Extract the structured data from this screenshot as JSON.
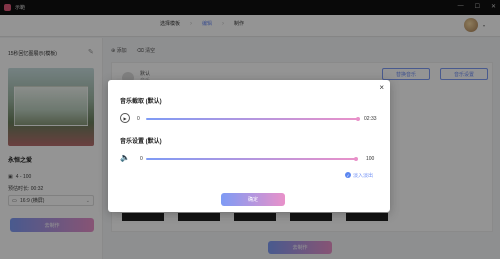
{
  "window": {
    "app_name": "示範",
    "controls": [
      "—",
      "☐",
      "✕"
    ]
  },
  "nav": {
    "steps": [
      "选择模板",
      "编辑",
      "制作"
    ]
  },
  "left_panel": {
    "title": "15秒回忆图展示(模板)",
    "project_name": "永恒之爱",
    "media_count": "4 - 100",
    "duration_label": "预估时长: 00:32",
    "ratio_value": "16:9 (横屏)",
    "make_button": "去制作"
  },
  "main": {
    "toolbar": {
      "add_label": "添加",
      "clear_label": "清空"
    },
    "music_row": {
      "label": "默认",
      "sub": "音乐"
    },
    "replace_music": "替换音乐",
    "music_settings": "音乐设置",
    "bottom_make": "去制作"
  },
  "modal": {
    "section1_title": "音乐截取 (默认)",
    "section1_start": "0",
    "section1_end": "02:33",
    "section2_title": "音乐设置 (默认)",
    "volume_min": "0",
    "volume_max": "100",
    "volume_value": 100,
    "fade_label": "淡入淡出",
    "fade_checked": true,
    "confirm": "确定",
    "close": "×"
  },
  "colors": {
    "accent_start": "#7e9bf5",
    "accent_end": "#e991c9",
    "link": "#6b8cf5"
  }
}
